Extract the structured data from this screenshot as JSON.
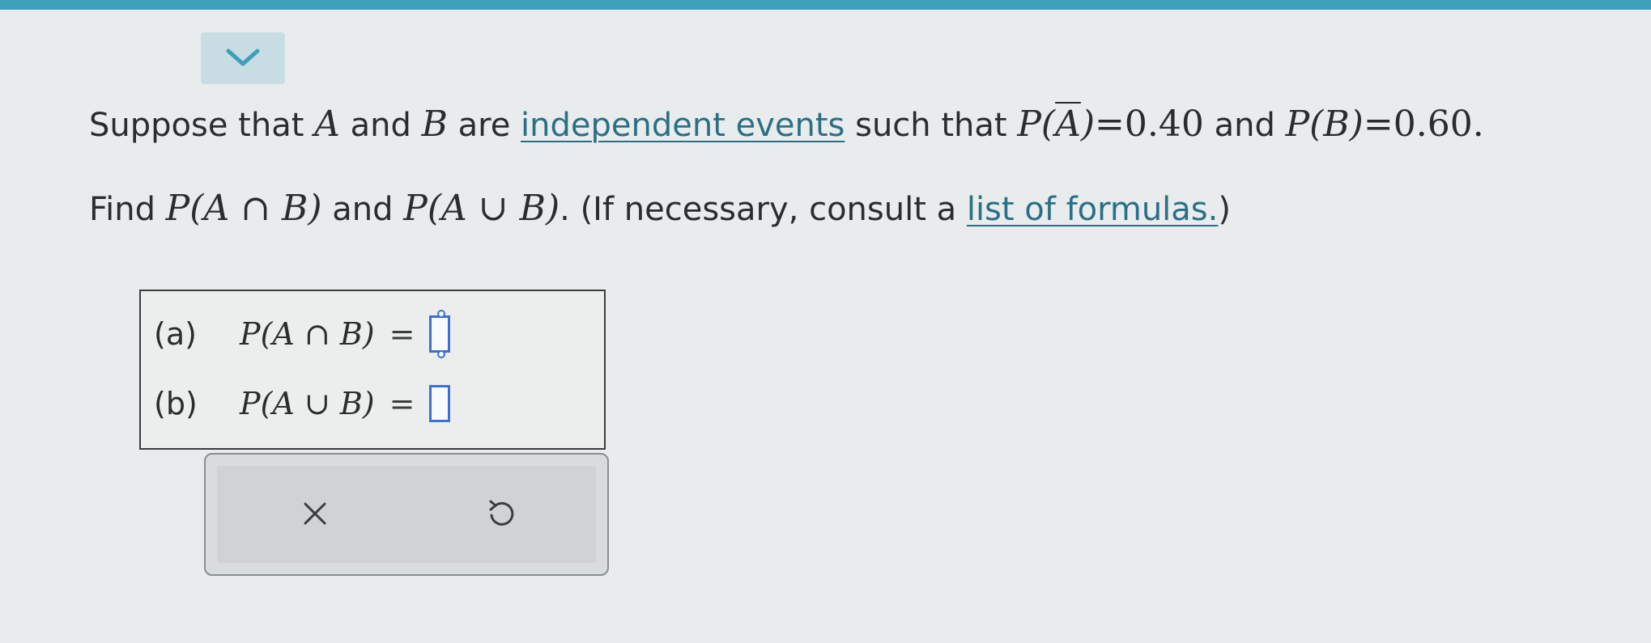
{
  "problem": {
    "line1": {
      "t1": "Suppose that ",
      "var_a": "A",
      "t2": " and ",
      "var_b": "B",
      "t3": " are ",
      "link_independent": "independent events",
      "t4": " such that ",
      "p_abar_open": "P(",
      "a_bar": "A",
      "p_abar_close": ")",
      "p_abar_value": "=0.40",
      "t5": " and ",
      "p_b": "P(B)",
      "p_b_value": "=0.60",
      "period": "."
    },
    "line2": {
      "t1": "Find ",
      "p_intersection": "P(A ∩ B)",
      "t2": " and ",
      "p_union": "P(A ∪ B)",
      "t3": ". (If necessary, consult a ",
      "link_formulas": "list of formulas.",
      "t4": ")"
    }
  },
  "answers": {
    "a": {
      "label": "(a)",
      "expr": "P(A ∩ B)",
      "equals": "=",
      "value": ""
    },
    "b": {
      "label": "(b)",
      "expr": "P(A ∪ B)",
      "equals": "=",
      "value": ""
    }
  },
  "toolbar": {
    "clear_icon": "close-icon",
    "undo_icon": "undo-icon"
  },
  "colors": {
    "top_strip": "#3d9fb9",
    "collapse_tab": "#c8dde3",
    "link": "#2b6f86",
    "input_border": "#3f6fd0"
  }
}
